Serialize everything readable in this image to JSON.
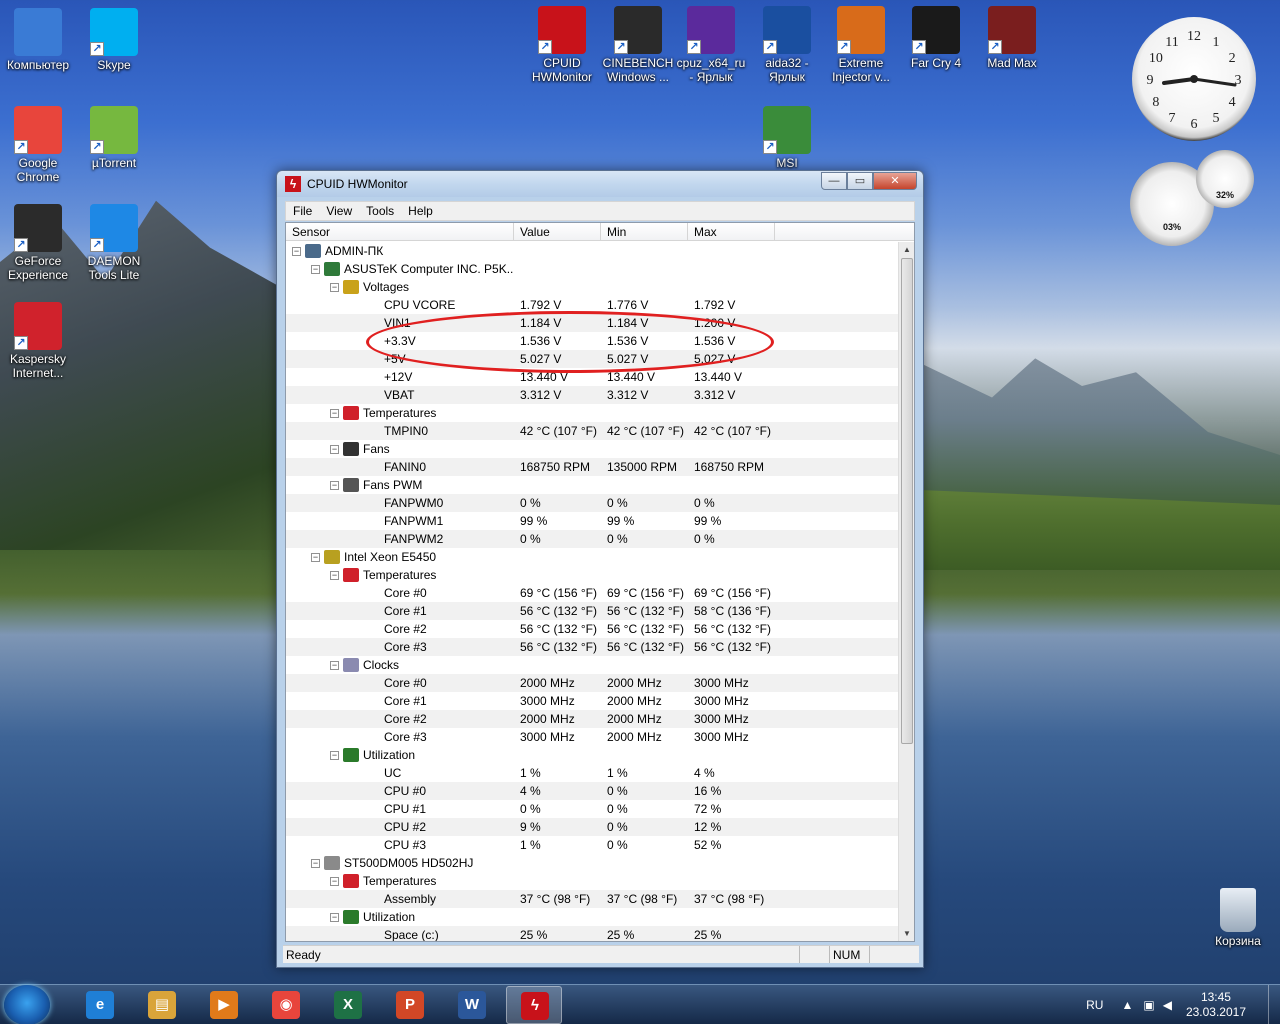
{
  "desktop": {
    "icons_left": [
      {
        "label": "Компьютер",
        "color": "#3a7bd5"
      },
      {
        "label": "Skype",
        "color": "#00aff0"
      },
      {
        "label": "Google Chrome",
        "color": "#e8453c"
      },
      {
        "label": "µTorrent",
        "color": "#76b83f"
      },
      {
        "label": "GeForce Experience",
        "color": "#2b2b2b"
      },
      {
        "label": "DAEMON Tools Lite",
        "color": "#1e88e5"
      },
      {
        "label": "Kaspersky Internet...",
        "color": "#d0222c"
      }
    ],
    "icons_top": [
      {
        "label": "CPUID HWMonitor",
        "color": "#c8121a"
      },
      {
        "label": "CINEBENCH Windows ...",
        "color": "#2a2a2a"
      },
      {
        "label": "cpuz_x64_ru - Ярлык",
        "color": "#5b2a9c"
      },
      {
        "label": "aida32 - Ярлык",
        "color": "#1a4fa0"
      },
      {
        "label": "Extreme Injector v...",
        "color": "#d86b1a"
      },
      {
        "label": "Far Cry 4",
        "color": "#1a1a1a"
      },
      {
        "label": "Mad Max",
        "color": "#7a1e1e"
      },
      {
        "label": "MSI",
        "color": "#3a8c3a"
      }
    ],
    "recycle_bin": "Корзина",
    "gadget_cpu_percent": "03%",
    "gadget_mem_percent": "32%",
    "clock_numbers": [
      "12",
      "1",
      "2",
      "3",
      "4",
      "5",
      "6",
      "7",
      "8",
      "9",
      "10",
      "11"
    ]
  },
  "window": {
    "title": "CPUID HWMonitor",
    "min": "0",
    "max": "1",
    "close": "r",
    "menu": [
      "File",
      "View",
      "Tools",
      "Help"
    ],
    "columns": [
      "Sensor",
      "Value",
      "Min",
      "Max"
    ],
    "status_ready": "Ready",
    "status_num": "NUM"
  },
  "rows": [
    {
      "level": 0,
      "exp": "-",
      "icon": "#4a6a8a",
      "name": "ADMIN-ПК",
      "v": "",
      "mn": "",
      "mx": ""
    },
    {
      "level": 1,
      "exp": "-",
      "icon": "#2f7a3a",
      "name": "ASUSTeK Computer INC. P5K...",
      "v": "",
      "mn": "",
      "mx": ""
    },
    {
      "level": 2,
      "exp": "-",
      "icon": "#c9a21a",
      "name": "Voltages",
      "v": "",
      "mn": "",
      "mx": ""
    },
    {
      "level": 3,
      "name": "CPU VCORE",
      "v": "1.792 V",
      "mn": "1.776 V",
      "mx": "1.792 V"
    },
    {
      "level": 3,
      "name": "VIN1",
      "v": "1.184 V",
      "mn": "1.184 V",
      "mx": "1.200 V"
    },
    {
      "level": 3,
      "name": "+3.3V",
      "v": "1.536 V",
      "mn": "1.536 V",
      "mx": "1.536 V"
    },
    {
      "level": 3,
      "name": "+5V",
      "v": "5.027 V",
      "mn": "5.027 V",
      "mx": "5.027 V"
    },
    {
      "level": 3,
      "name": "+12V",
      "v": "13.440 V",
      "mn": "13.440 V",
      "mx": "13.440 V"
    },
    {
      "level": 3,
      "name": "VBAT",
      "v": "3.312 V",
      "mn": "3.312 V",
      "mx": "3.312 V"
    },
    {
      "level": 2,
      "exp": "-",
      "icon": "#d0202a",
      "name": "Temperatures",
      "v": "",
      "mn": "",
      "mx": ""
    },
    {
      "level": 3,
      "name": "TMPIN0",
      "v": "42 °C  (107 °F)",
      "mn": "42 °C  (107 °F)",
      "mx": "42 °C  (107 °F)"
    },
    {
      "level": 2,
      "exp": "-",
      "icon": "#333333",
      "name": "Fans",
      "v": "",
      "mn": "",
      "mx": ""
    },
    {
      "level": 3,
      "name": "FANIN0",
      "v": "168750 RPM",
      "mn": "135000 RPM",
      "mx": "168750 RPM"
    },
    {
      "level": 2,
      "exp": "-",
      "icon": "#555555",
      "name": "Fans PWM",
      "v": "",
      "mn": "",
      "mx": ""
    },
    {
      "level": 3,
      "name": "FANPWM0",
      "v": "0 %",
      "mn": "0 %",
      "mx": "0 %"
    },
    {
      "level": 3,
      "name": "FANPWM1",
      "v": "99 %",
      "mn": "99 %",
      "mx": "99 %"
    },
    {
      "level": 3,
      "name": "FANPWM2",
      "v": "0 %",
      "mn": "0 %",
      "mx": "0 %"
    },
    {
      "level": 1,
      "exp": "-",
      "icon": "#b8a020",
      "name": "Intel Xeon E5450",
      "v": "",
      "mn": "",
      "mx": ""
    },
    {
      "level": 2,
      "exp": "-",
      "icon": "#d0202a",
      "name": "Temperatures",
      "v": "",
      "mn": "",
      "mx": ""
    },
    {
      "level": 3,
      "name": "Core #0",
      "v": "69 °C  (156 °F)",
      "mn": "69 °C  (156 °F)",
      "mx": "69 °C  (156 °F)"
    },
    {
      "level": 3,
      "name": "Core #1",
      "v": "56 °C  (132 °F)",
      "mn": "56 °C  (132 °F)",
      "mx": "58 °C  (136 °F)"
    },
    {
      "level": 3,
      "name": "Core #2",
      "v": "56 °C  (132 °F)",
      "mn": "56 °C  (132 °F)",
      "mx": "56 °C  (132 °F)"
    },
    {
      "level": 3,
      "name": "Core #3",
      "v": "56 °C  (132 °F)",
      "mn": "56 °C  (132 °F)",
      "mx": "56 °C  (132 °F)"
    },
    {
      "level": 2,
      "exp": "-",
      "icon": "#8a8ab0",
      "name": "Clocks",
      "v": "",
      "mn": "",
      "mx": ""
    },
    {
      "level": 3,
      "name": "Core #0",
      "v": "2000 MHz",
      "mn": "2000 MHz",
      "mx": "3000 MHz"
    },
    {
      "level": 3,
      "name": "Core #1",
      "v": "3000 MHz",
      "mn": "2000 MHz",
      "mx": "3000 MHz"
    },
    {
      "level": 3,
      "name": "Core #2",
      "v": "2000 MHz",
      "mn": "2000 MHz",
      "mx": "3000 MHz"
    },
    {
      "level": 3,
      "name": "Core #3",
      "v": "3000 MHz",
      "mn": "2000 MHz",
      "mx": "3000 MHz"
    },
    {
      "level": 2,
      "exp": "-",
      "icon": "#2a7a2a",
      "name": "Utilization",
      "v": "",
      "mn": "",
      "mx": ""
    },
    {
      "level": 3,
      "name": "UC",
      "v": "1 %",
      "mn": "1 %",
      "mx": "4 %"
    },
    {
      "level": 3,
      "name": "CPU #0",
      "v": "4 %",
      "mn": "0 %",
      "mx": "16 %"
    },
    {
      "level": 3,
      "name": "CPU #1",
      "v": "0 %",
      "mn": "0 %",
      "mx": "72 %"
    },
    {
      "level": 3,
      "name": "CPU #2",
      "v": "9 %",
      "mn": "0 %",
      "mx": "12 %"
    },
    {
      "level": 3,
      "name": "CPU #3",
      "v": "1 %",
      "mn": "0 %",
      "mx": "52 %"
    },
    {
      "level": 1,
      "exp": "-",
      "icon": "#8a8a8a",
      "name": "ST500DM005 HD502HJ",
      "v": "",
      "mn": "",
      "mx": ""
    },
    {
      "level": 2,
      "exp": "-",
      "icon": "#d0202a",
      "name": "Temperatures",
      "v": "",
      "mn": "",
      "mx": ""
    },
    {
      "level": 3,
      "name": "Assembly",
      "v": "37 °C  (98 °F)",
      "mn": "37 °C  (98 °F)",
      "mx": "37 °C  (98 °F)"
    },
    {
      "level": 2,
      "exp": "-",
      "icon": "#2a7a2a",
      "name": "Utilization",
      "v": "",
      "mn": "",
      "mx": ""
    },
    {
      "level": 3,
      "name": "Space (c:)",
      "v": "25 %",
      "mn": "25 %",
      "mx": "25 %"
    }
  ],
  "taskbar": {
    "apps": [
      {
        "name": "internet-explorer",
        "glyph": "e",
        "color": "#1f7fd6"
      },
      {
        "name": "file-explorer",
        "glyph": "▤",
        "color": "#d9a43a"
      },
      {
        "name": "media-player",
        "glyph": "▶",
        "color": "#e07a1a"
      },
      {
        "name": "chrome",
        "glyph": "◉",
        "color": "#e8453c"
      },
      {
        "name": "excel",
        "glyph": "X",
        "color": "#1e7145"
      },
      {
        "name": "powerpoint",
        "glyph": "P",
        "color": "#d24726"
      },
      {
        "name": "word",
        "glyph": "W",
        "color": "#2b579a"
      },
      {
        "name": "hwmonitor",
        "glyph": "ϟ",
        "color": "#c8121a",
        "active": true
      }
    ],
    "language": "RU",
    "time": "13:45",
    "date": "23.03.2017"
  }
}
